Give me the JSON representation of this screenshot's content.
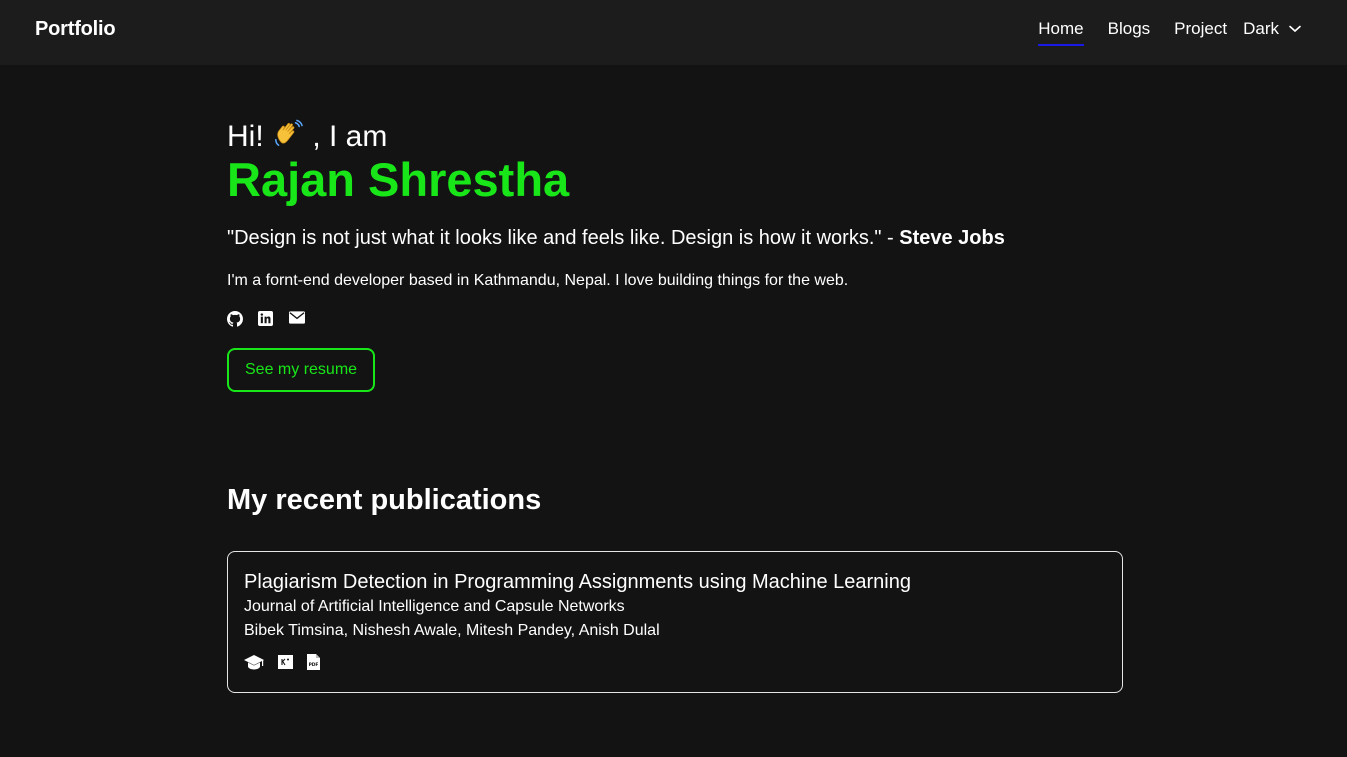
{
  "nav": {
    "brand": "Portfolio",
    "links": [
      {
        "label": "Home",
        "active": true
      },
      {
        "label": "Blogs",
        "active": false
      },
      {
        "label": "Project",
        "active": false
      }
    ],
    "theme": {
      "selected": "Dark",
      "icon": "chevron-down-icon"
    }
  },
  "hero": {
    "greeting_pre": "Hi! ",
    "greeting_post": ", I am",
    "wave_icon": "waving-hand-icon",
    "name": "Rajan Shrestha",
    "quote_text": "\"Design is not just what it looks like and feels like. Design is how it works.\" - ",
    "quote_author": "Steve Jobs",
    "bio": "I'm a fornt-end developer based in Kathmandu, Nepal. I love building things for the web.",
    "social_icons": [
      "github-icon",
      "linkedin-icon",
      "email-icon"
    ],
    "resume_label": "See my resume"
  },
  "publications": {
    "title": "My recent publications",
    "items": [
      {
        "title": "Plagiarism Detection in Programming Assignments using Machine Learning",
        "journal": "Journal of Artificial Intelligence and Capsule Networks",
        "authors": "Bibek Timsina, Nishesh Awale, Mitesh Pandey, Anish Dulal",
        "icons": [
          "graduation-cap-icon",
          "citation-icon",
          "pdf-icon"
        ]
      }
    ]
  },
  "colors": {
    "background": "#131313",
    "navbar": "#1c1c1c",
    "accent": "#19e619",
    "active_underline": "#1a1ae6"
  }
}
